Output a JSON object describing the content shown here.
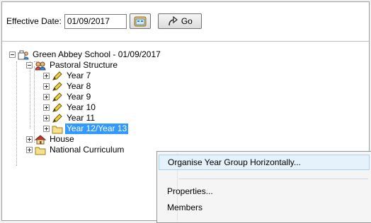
{
  "toolbar": {
    "effective_label": "Effective Date:",
    "effective_date": "01/09/2017",
    "go_label": "Go"
  },
  "tree": {
    "root": "Green Abbey School - 01/09/2017",
    "pastoral": "Pastoral Structure",
    "years": [
      "Year 7",
      "Year 8",
      "Year 9",
      "Year 10",
      "Year 11"
    ],
    "selected": "Year 12/Year 13",
    "house": "House",
    "national": "National Curriculum"
  },
  "context_menu": {
    "items": [
      "Organise Year Group Horizontally...",
      "Properties...",
      "Members"
    ]
  }
}
